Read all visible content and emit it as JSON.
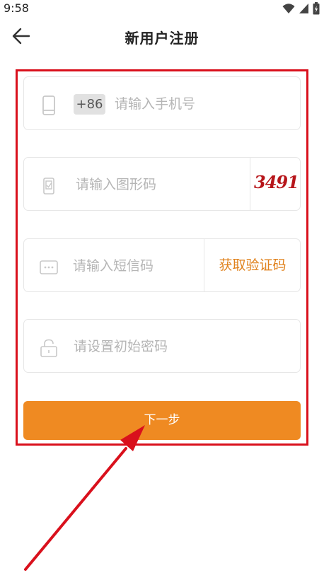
{
  "status_bar": {
    "time": "9:58",
    "icons": [
      "wifi-icon",
      "signal-icon",
      "battery-icon"
    ]
  },
  "header": {
    "title": "新用户注册",
    "back_icon": "arrow-left-icon"
  },
  "form": {
    "phone": {
      "icon": "phone-icon",
      "country_code": "+86",
      "placeholder": "请输入手机号",
      "value": ""
    },
    "captcha": {
      "icon": "image-code-icon",
      "placeholder": "请输入图形码",
      "value": "",
      "captcha_text": "3491"
    },
    "sms": {
      "icon": "message-icon",
      "placeholder": "请输入短信码",
      "value": "",
      "get_code_label": "获取验证码"
    },
    "password": {
      "icon": "lock-icon",
      "placeholder": "请设置初始密码",
      "value": ""
    },
    "next_label": "下一步"
  },
  "colors": {
    "accent": "#ef8a22",
    "highlight": "#d9101c",
    "captcha": "#b7151a",
    "placeholder": "#b5b5b5",
    "border": "#e6e6e6"
  }
}
